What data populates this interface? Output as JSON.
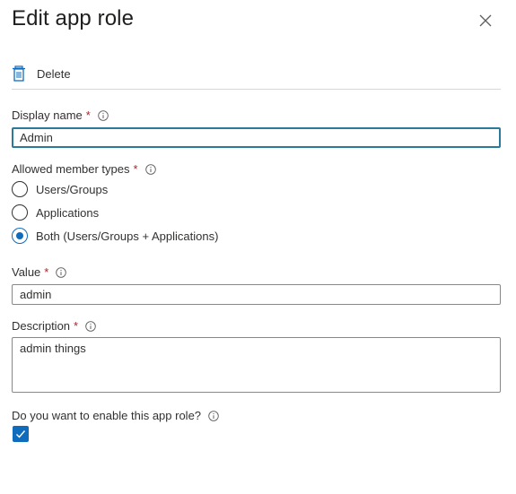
{
  "panel": {
    "title": "Edit app role"
  },
  "toolbar": {
    "delete_label": "Delete"
  },
  "form": {
    "display_name": {
      "label": "Display name",
      "required_mark": "*",
      "value": "Admin"
    },
    "member_types": {
      "label": "Allowed member types",
      "required_mark": "*",
      "options": [
        {
          "label": "Users/Groups",
          "selected": false
        },
        {
          "label": "Applications",
          "selected": false
        },
        {
          "label": "Both (Users/Groups + Applications)",
          "selected": true
        }
      ]
    },
    "value": {
      "label": "Value",
      "required_mark": "*",
      "value": "admin"
    },
    "description": {
      "label": "Description",
      "required_mark": "*",
      "value": "admin things"
    },
    "enable": {
      "label": "Do you want to enable this app role?",
      "checked": true
    }
  },
  "colors": {
    "accent": "#0f6cbd",
    "required": "#a4262c",
    "text": "#323130"
  }
}
